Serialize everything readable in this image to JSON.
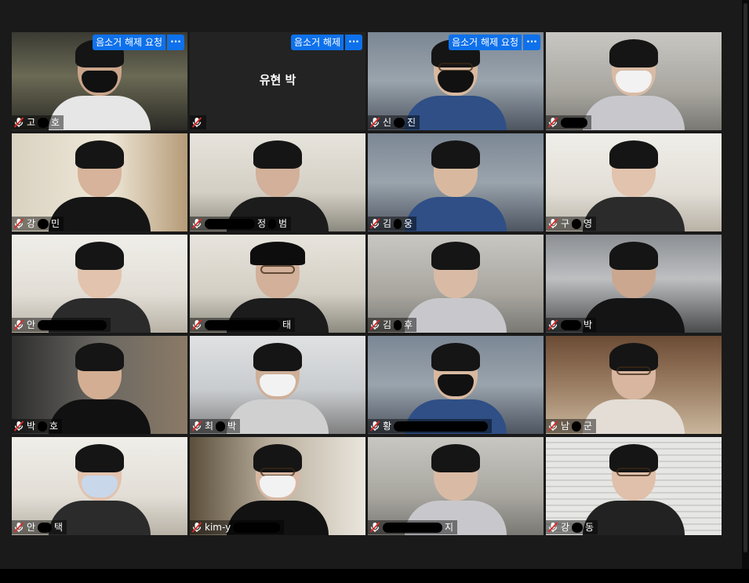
{
  "meeting": {
    "unmute_request_label": "음소거 해제 요청",
    "unmute_label_short": "음소거 해제",
    "more_label": "···",
    "mic_icon": "microphone-muted-icon",
    "accent_color": "#0e71eb",
    "active_speaker_color": "#e9e83c"
  },
  "participants": [
    {
      "name_pre": "고",
      "name_post": "호",
      "redact_w": 14,
      "has_unmute": true,
      "unmute_short": false,
      "tone": "night",
      "mask": "black",
      "video": true
    },
    {
      "name_pre": "",
      "name_post": "",
      "redact_w": 0,
      "has_unmute": true,
      "unmute_short": true,
      "tone": "novideo",
      "video": false,
      "display_name": "유현 박"
    },
    {
      "name_pre": "신",
      "name_post": "진",
      "redact_w": 14,
      "has_unmute": true,
      "unmute_short": false,
      "tone": "office",
      "mask": "black",
      "glasses": true,
      "video": true
    },
    {
      "name_pre": "",
      "name_post": "",
      "redact_w": 34,
      "has_unmute": false,
      "tone": "office2",
      "mask": "white",
      "video": true
    },
    {
      "name_pre": "강",
      "name_post": "민",
      "redact_w": 14,
      "has_unmute": false,
      "tone": "room",
      "video": true
    },
    {
      "name_pre": "",
      "name_post": "정",
      "name_tail": "범",
      "redact_w": 64,
      "redact2_w": 10,
      "has_unmute": false,
      "tone": "room2",
      "video": true
    },
    {
      "name_pre": "김",
      "name_post": "웅",
      "redact_w": 10,
      "has_unmute": false,
      "tone": "office",
      "video": true
    },
    {
      "name_pre": "구",
      "name_post": "영",
      "redact_w": 12,
      "has_unmute": false,
      "tone": "white",
      "video": true
    },
    {
      "name_pre": "안",
      "name_post": "",
      "redact_w": 88,
      "has_unmute": false,
      "tone": "white",
      "video": true
    },
    {
      "name_pre": "",
      "name_post": "태",
      "redact_w": 96,
      "has_unmute": false,
      "tone": "room2",
      "glasses": true,
      "cap": true,
      "video": true
    },
    {
      "name_pre": "김",
      "name_post": "후",
      "redact_w": 10,
      "has_unmute": false,
      "tone": "office2",
      "video": true
    },
    {
      "name_pre": "",
      "name_post": "박",
      "redact_w": 26,
      "has_unmute": false,
      "tone": "dim",
      "active": true,
      "video": true
    },
    {
      "name_pre": "박",
      "name_post": "호",
      "redact_w": 12,
      "has_unmute": false,
      "tone": "gaming",
      "video": true
    },
    {
      "name_pre": "최",
      "name_post": "박",
      "redact_w": 12,
      "has_unmute": false,
      "tone": "desk",
      "mask": "white",
      "video": true
    },
    {
      "name_pre": "황",
      "name_post": "",
      "redact_w": 120,
      "has_unmute": false,
      "tone": "office",
      "mask": "black",
      "video": true
    },
    {
      "name_pre": "남",
      "name_post": "군",
      "redact_w": 12,
      "has_unmute": false,
      "tone": "shelf",
      "glasses": true,
      "video": true
    },
    {
      "name_pre": "안",
      "name_post": "택",
      "redact_w": 18,
      "has_unmute": false,
      "tone": "white",
      "mask": "blue",
      "video": true
    },
    {
      "name_pre": "kim-y",
      "name_post": "",
      "redact_w": 60,
      "has_unmute": false,
      "tone": "closet",
      "mask": "white",
      "glasses": true,
      "video": true
    },
    {
      "name_pre": "",
      "name_post": "지",
      "redact_w": 76,
      "has_unmute": false,
      "tone": "office2",
      "video": true
    },
    {
      "name_pre": "강",
      "name_post": "동",
      "redact_w": 14,
      "has_unmute": false,
      "tone": "blinds",
      "glasses": true,
      "video": true
    }
  ]
}
